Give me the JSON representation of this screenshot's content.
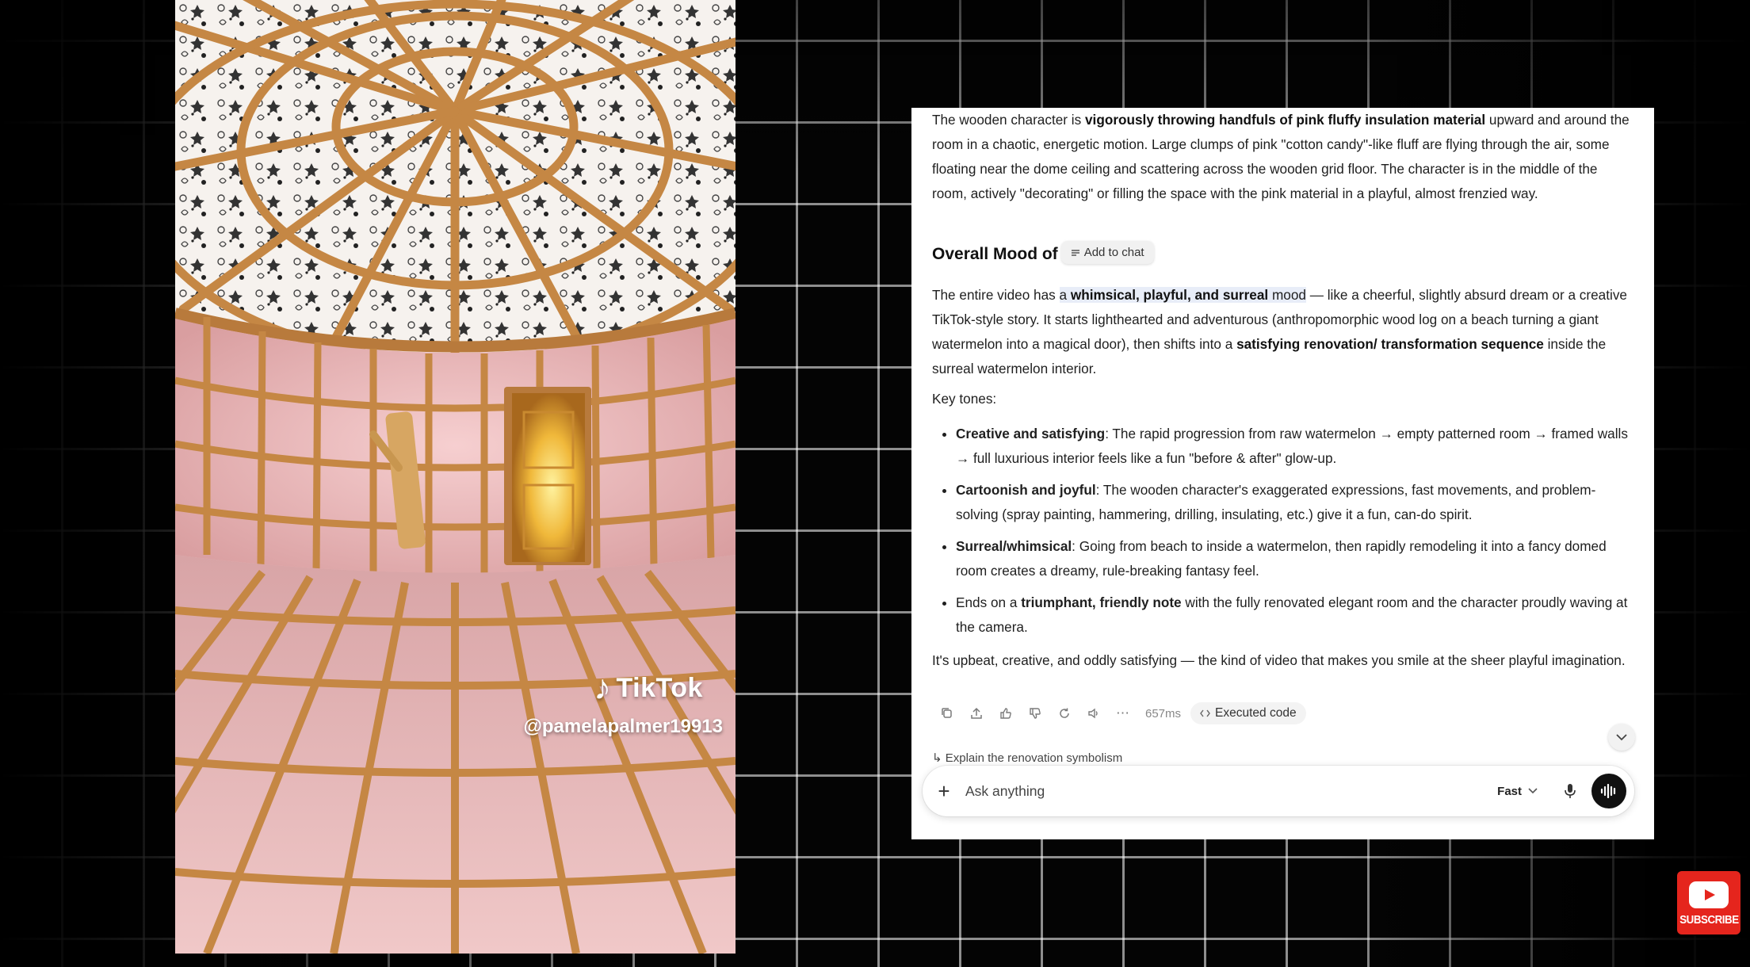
{
  "video": {
    "watermark_brand": "TikTok",
    "watermark_handle": "@pamelapalmer19913"
  },
  "chat": {
    "intro": {
      "t1": "The wooden character is ",
      "b1": "vigorously throwing handfuls of pink fluffy insulation material",
      "t2": " upward and around the room in a chaotic, energetic motion. Large clumps of pink \"cotton candy\"-like fluff are flying through the air, some floating near the dome ceiling and scattering across the wooden grid floor. The character is in the middle of the room, actively \"decorating\" or filling the space with the pink material in a playful, almost frenzied way."
    },
    "mood_heading": "Overall Mood of",
    "add_to_chat_label": "Add to chat",
    "mood_para": {
      "t1": "The entire video has ",
      "h1": "a ",
      "b1": "whimsical, playful, and surreal",
      "h2": " mood",
      "t2": " — like a cheerful, slightly absurd dream or a creative TikTok-style story. It starts lighthearted and adventurous (anthropomorphic wood log on a beach turning a giant watermelon into a magical door), then shifts into a ",
      "b2": "satisfying renovation/ transformation sequence",
      "t3": " inside the surreal watermelon interior."
    },
    "key_tones_label": "Key tones:",
    "tones": [
      {
        "bold": "Creative and satisfying",
        "text": ": The rapid progression from raw watermelon → empty patterned room → framed walls → full luxurious interior feels like a fun \"before & after\" glow-up."
      },
      {
        "bold": "Cartoonish and joyful",
        "text": ": The wooden character's exaggerated expressions, fast movements, and problem-solving (spray painting, hammering, drilling, insulating, etc.) give it a fun, can-do spirit."
      },
      {
        "bold": "Surreal/whimsical",
        "text": ": Going from beach to inside a watermelon, then rapidly remodeling it into a fancy domed room creates a dreamy, rule-breaking fantasy feel."
      },
      {
        "pre": "Ends on a ",
        "bold": "triumphant, friendly note",
        "text": " with the fully renovated elegant room and the character proudly waving at the camera."
      }
    ],
    "closing": "It's upbeat, creative, and oddly satisfying — the kind of video that makes you smile at the sheer playful imagination.",
    "actions": {
      "latency": "657ms",
      "executed_code_label": "Executed code"
    },
    "suggestion": "Explain the renovation symbolism",
    "input": {
      "placeholder": "Ask anything",
      "mode_label": "Fast"
    }
  },
  "subscribe_label": "SUBSCRIBE"
}
